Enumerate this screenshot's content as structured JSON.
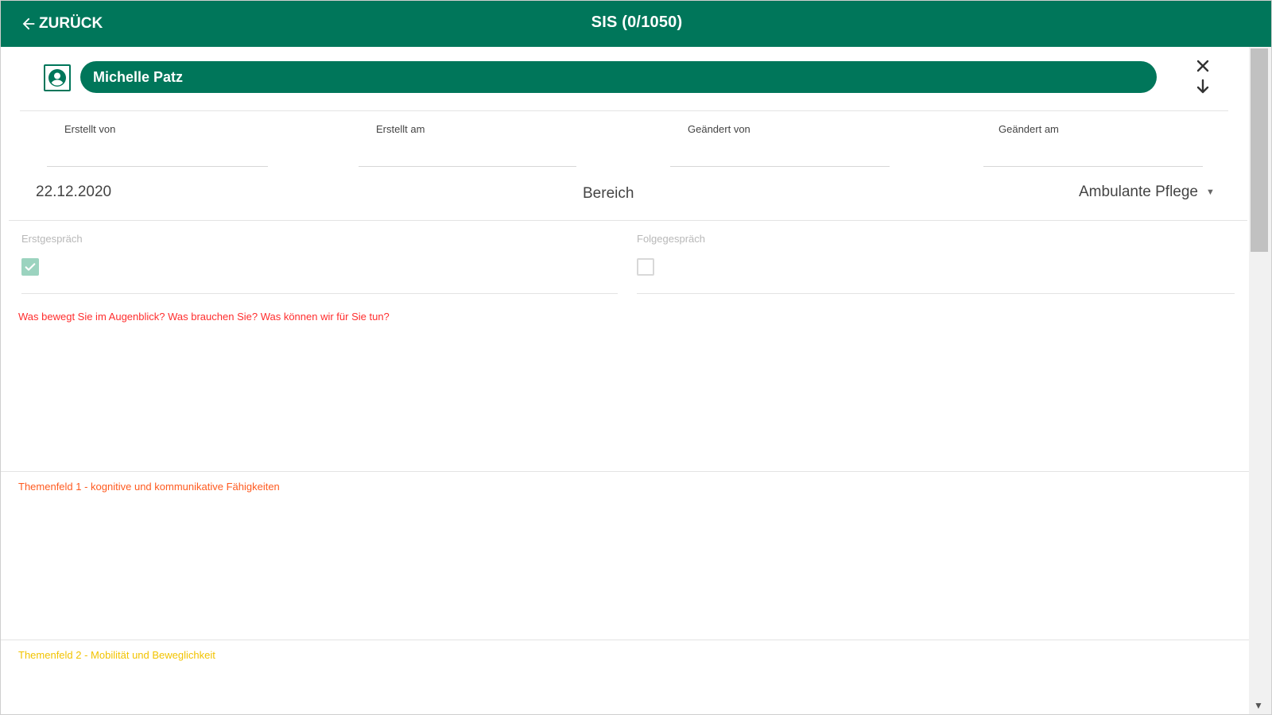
{
  "header": {
    "back_label": "ZURÜCK",
    "title": "SIS (0/1050)"
  },
  "patient": {
    "name": "Michelle Patz"
  },
  "meta": {
    "created_by_label": "Erstellt von",
    "created_at_label": "Erstellt am",
    "changed_by_label": "Geändert von",
    "changed_at_label": "Geändert am",
    "created_by_value": "",
    "created_at_value": "",
    "changed_by_value": "",
    "changed_at_value": ""
  },
  "form": {
    "date": "22.12.2020",
    "bereich_label": "Bereich",
    "bereich_value": "Ambulante Pflege",
    "erstgespraech_label": "Erstgespräch",
    "erstgespraech_checked": true,
    "folgegespraech_label": "Folgegespräch",
    "folgegespraech_checked": false
  },
  "sections": [
    {
      "title": "Was bewegt Sie im Augenblick? Was brauchen Sie? Was können wir für Sie tun?",
      "color": "#ff2d2d"
    },
    {
      "title": "Themenfeld 1 - kognitive und kommunikative Fähigkeiten",
      "color": "#ff5a1f"
    },
    {
      "title": "Themenfeld 2 - Mobilität und Beweglichkeit",
      "color": "#f2c300"
    }
  ],
  "colors": {
    "brand": "#00765a",
    "checked_box": "#9bd3bf"
  }
}
